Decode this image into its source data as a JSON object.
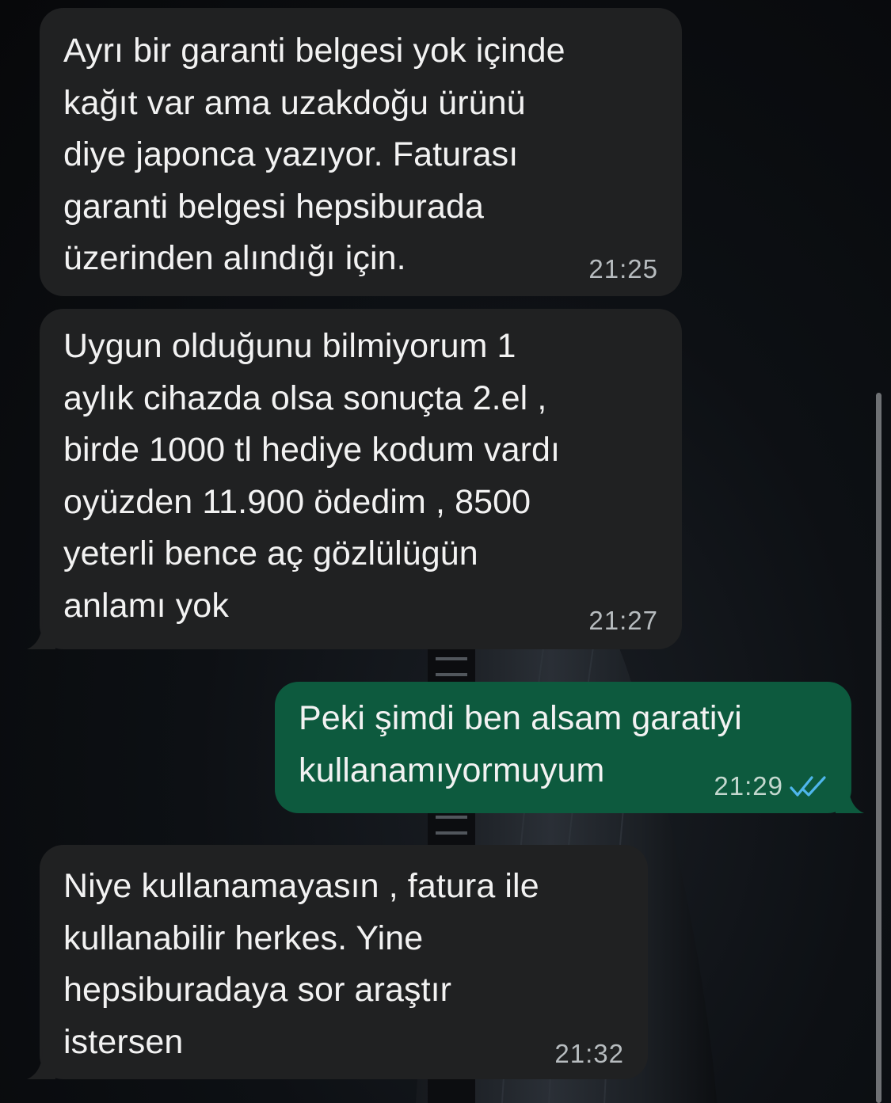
{
  "messages": [
    {
      "direction": "incoming",
      "text": "Ayrı bir garanti belgesi yok içinde\nkağıt var ama uzakdoğu ürünü\ndiye japonca yazıyor. Faturası\ngaranti belgesi hepsiburada\nüzerinden alındığı için.",
      "time": "21:25"
    },
    {
      "direction": "incoming",
      "text": "Uygun olduğunu bilmiyorum 1\naylık cihazda olsa sonuçta 2.el ,\nbirde 1000 tl hediye kodum vardı\noyüzden 11.900 ödedim , 8500\nyeterli bence aç gözlülügün\nanlamı yok",
      "time": "21:27"
    },
    {
      "direction": "outgoing",
      "text": "Peki şimdi ben alsam garatiyi\nkullanamıyormuyum",
      "time": "21:29",
      "status_icon": "double-check-read-icon"
    },
    {
      "direction": "incoming",
      "text": "Niye kullanamayasın , fatura ile\nkullanabilir herkes. Yine\nhepsiburadaya sor araştır\nistersen",
      "time": "21:32"
    }
  ],
  "colors": {
    "incoming_bubble": "#202122",
    "outgoing_bubble": "#0d5a3e",
    "read_receipt": "#4fb6ec",
    "background": "#0b0d10"
  }
}
